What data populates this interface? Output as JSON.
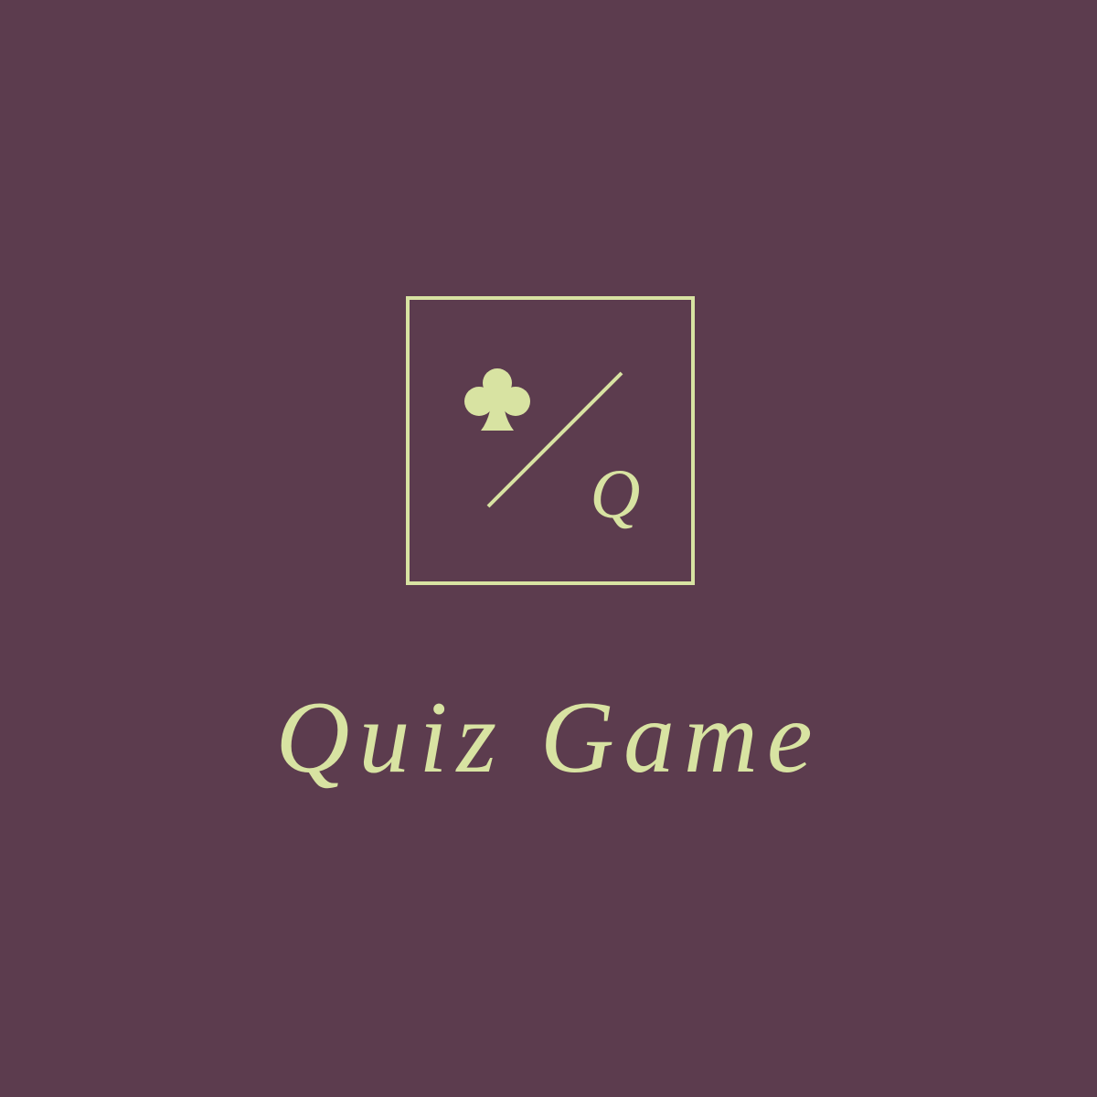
{
  "colors": {
    "background": "#5c3c4e",
    "accent": "#d8e3a2"
  },
  "logo": {
    "suit_icon": "club-icon",
    "letter": "Q",
    "divider_icon": "slash-line"
  },
  "title": "Quiz Game"
}
